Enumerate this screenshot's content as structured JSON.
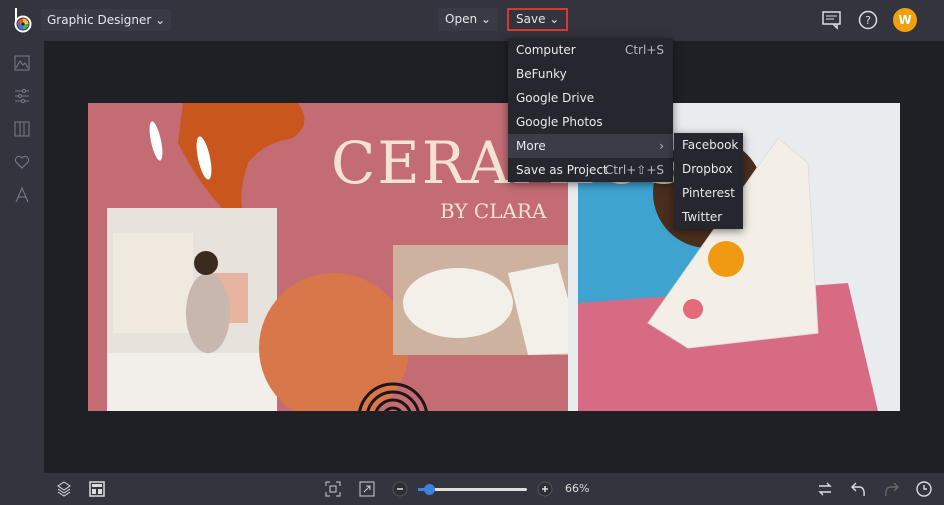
{
  "header": {
    "project_label": "Graphic Designer",
    "open_label": "Open",
    "save_label": "Save",
    "avatar_initial": "W"
  },
  "save_menu": {
    "items": [
      {
        "label": "Computer",
        "shortcut": "Ctrl+S"
      },
      {
        "label": "BeFunky",
        "shortcut": ""
      },
      {
        "label": "Google Drive",
        "shortcut": ""
      },
      {
        "label": "Google Photos",
        "shortcut": ""
      },
      {
        "label": "More",
        "shortcut": "›"
      },
      {
        "label": "Save as Project",
        "shortcut": "Ctrl+⇧+S"
      }
    ],
    "more_submenu": [
      "Facebook",
      "Dropbox",
      "Pinterest",
      "Twitter"
    ]
  },
  "canvas": {
    "title": "CERAMICS",
    "subtitle": "BY CLARA",
    "background": "#c46c74",
    "accent": "#c9561c"
  },
  "footer": {
    "zoom_label": "66%",
    "slider_fraction": 0.1
  }
}
